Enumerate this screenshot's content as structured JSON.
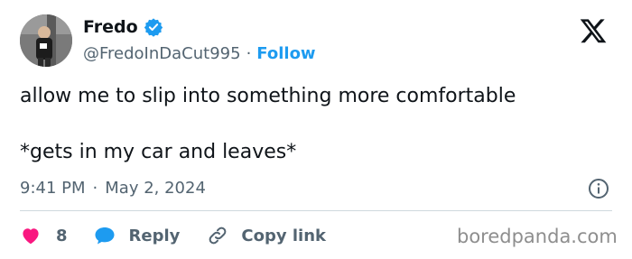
{
  "author": {
    "display_name": "Fredo",
    "handle": "@FredoInDaCut995",
    "follow_label": "Follow",
    "verified_icon": "verified-badge-icon",
    "verified_color": "#1d9bf0"
  },
  "tweet": {
    "line1": "allow me to slip into something more comfortable",
    "line2": "*gets in my car and leaves*"
  },
  "meta": {
    "time": "9:41 PM",
    "separator": "·",
    "date": "May 2, 2024"
  },
  "actions": {
    "like_count": "8",
    "reply_label": "Reply",
    "copy_link_label": "Copy link",
    "like_color": "#f91880",
    "reply_color": "#1d9bf0"
  },
  "header": {
    "handle_separator": "·",
    "platform_logo": "x-logo-icon"
  },
  "watermark": "boredpanda.com"
}
